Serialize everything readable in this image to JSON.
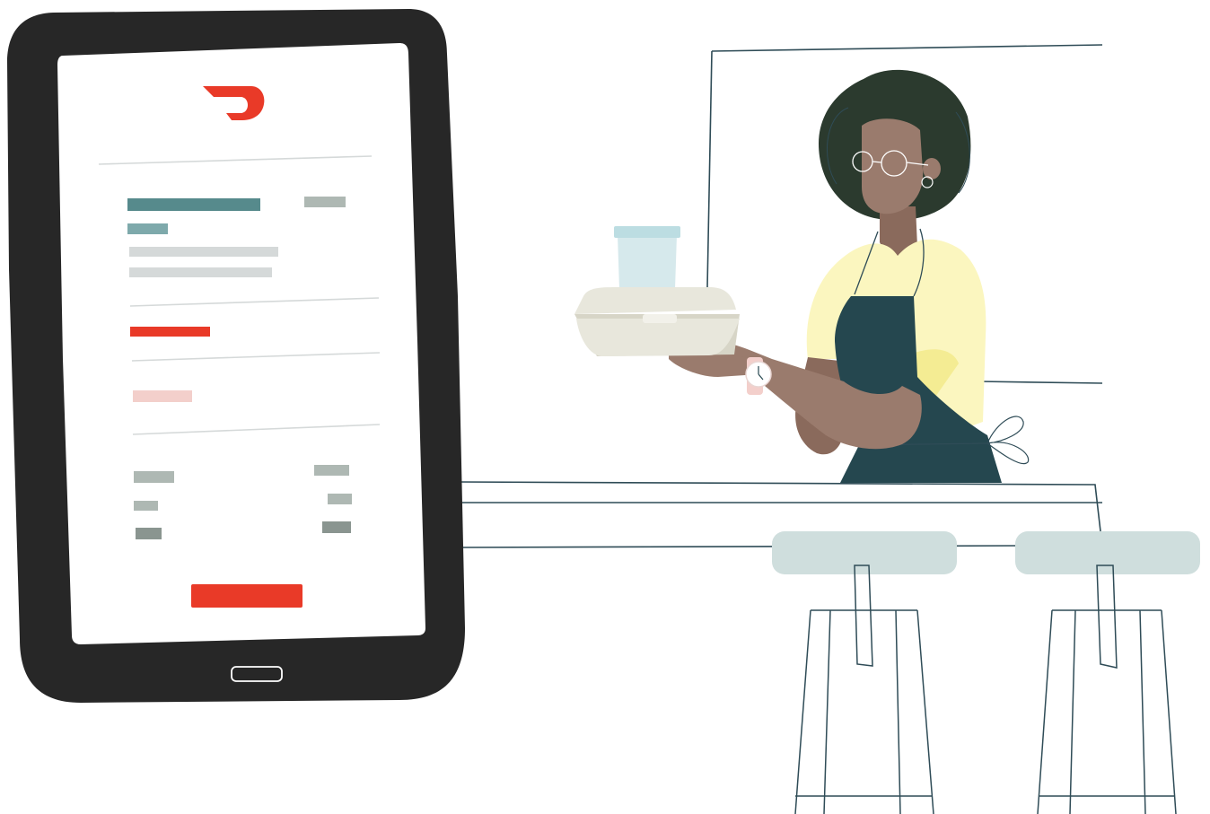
{
  "colors": {
    "background": "#ffffff",
    "tablet_frame": "#272727",
    "tablet_screen": "#ffffff",
    "brand_red": "#e93a28",
    "teal_dark": "#568a8c",
    "teal_light": "#7ea9ab",
    "gray_line": "#d5d9d9",
    "gray_block": "#aeb8b3",
    "gray_block_dark": "#8a9590",
    "pink_light": "#f3cfcb",
    "line_navy": "#2f4c57",
    "stool_seat": "#cfdedd",
    "hair": "#2b3a2e",
    "skin": "#9a7b6d",
    "skin_dark": "#8a6a5c",
    "shirt_yellow": "#fbf6bf",
    "shirt_yellow_shade": "#f4ec93",
    "apron": "#25474f",
    "cup": "#d6e9ec",
    "cup_lid": "#bcdde2",
    "food_box": "#e8e7dc",
    "food_box_shade": "#d7d5c7"
  },
  "illustration": {
    "tablet_app": {
      "logo": "doordash-logo-icon",
      "primary_button": "red-button",
      "blocks": "placeholder-text-lines"
    },
    "worker": {
      "items": [
        "drink-cup",
        "takeout-box"
      ]
    },
    "counter": {
      "stools": 2
    }
  }
}
